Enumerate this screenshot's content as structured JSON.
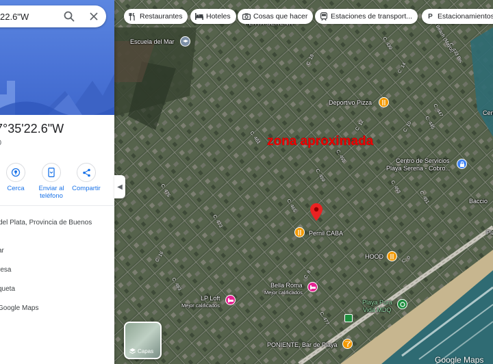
{
  "search": {
    "query": "22.6\"W"
  },
  "place": {
    "title": "7°35'22.6\"W",
    "subtitle": "0"
  },
  "actions": [
    {
      "label": "Cerca"
    },
    {
      "label": "Enviar al teléfono"
    },
    {
      "label": "Compartir"
    }
  ],
  "info_rows": [
    "del Plata, Provincia de Buenos",
    "ar",
    "resa",
    "queta",
    "Google Maps"
  ],
  "chips": [
    {
      "label": "Restaurantes",
      "icon": "fork-knife-icon"
    },
    {
      "label": "Hoteles",
      "icon": "bed-icon"
    },
    {
      "label": "Cosas que hacer",
      "icon": "camera-icon"
    },
    {
      "label": "Estaciones de transport...",
      "icon": "transit-icon"
    },
    {
      "label": "Estacionamientos",
      "icon": "parking-icon"
    }
  ],
  "map": {
    "overlay_text": "zona aproximada",
    "pois": [
      {
        "name": "Escuela del Mar",
        "kind": "school",
        "color": "#7c8fa6"
      },
      {
        "name": "Deportivo Pizza",
        "kind": "restaurant",
        "color": "#f29900"
      },
      {
        "name": "Centro de Servicios",
        "name2": "Playa Serena - Cobro...",
        "kind": "service",
        "color": "#4285f4"
      },
      {
        "name": "Pernil CABA",
        "kind": "restaurant",
        "color": "#f29900"
      },
      {
        "name": "HOOD",
        "kind": "restaurant",
        "color": "#f29900"
      },
      {
        "name": "Bella Roma",
        "sub": "Mejor calificados",
        "kind": "hotel",
        "color": "#e52592"
      },
      {
        "name": "LP Loft",
        "sub": "Mejor calificados",
        "kind": "hotel",
        "color": "#e52592"
      },
      {
        "name": "Playa Pura",
        "name2": "Vida MDQ",
        "kind": "park",
        "color": "#1e8e3e"
      },
      {
        "name": "PONIENTE, Bar de Playa",
        "kind": "bar",
        "color": "#f29900"
      },
      {
        "name": "Baccio",
        "kind": "place",
        "color": "#ffffff"
      },
      {
        "name": "Cen",
        "kind": "place",
        "color": "#ffffff"
      },
      {
        "name": "Pla",
        "kind": "place",
        "color": "#ffffff"
      }
    ],
    "area_label": "PLAYA SERENA",
    "streets": [
      "C. 439",
      "C. 433 Bis",
      "C. 18",
      "C. 14",
      "C. 12",
      "C. 10",
      "C. 447",
      "C. 445",
      "C. 461",
      "C. 455",
      "C. 459",
      "C. 453",
      "C. 451",
      "C. 475",
      "C. 465",
      "C. 473",
      "C. 16",
      "C. 483",
      "C. 477",
      "C. 8",
      "C. 0",
      "Camino Beach (Mayol)"
    ],
    "layers_label": "Capas",
    "logo": "Google Maps"
  }
}
